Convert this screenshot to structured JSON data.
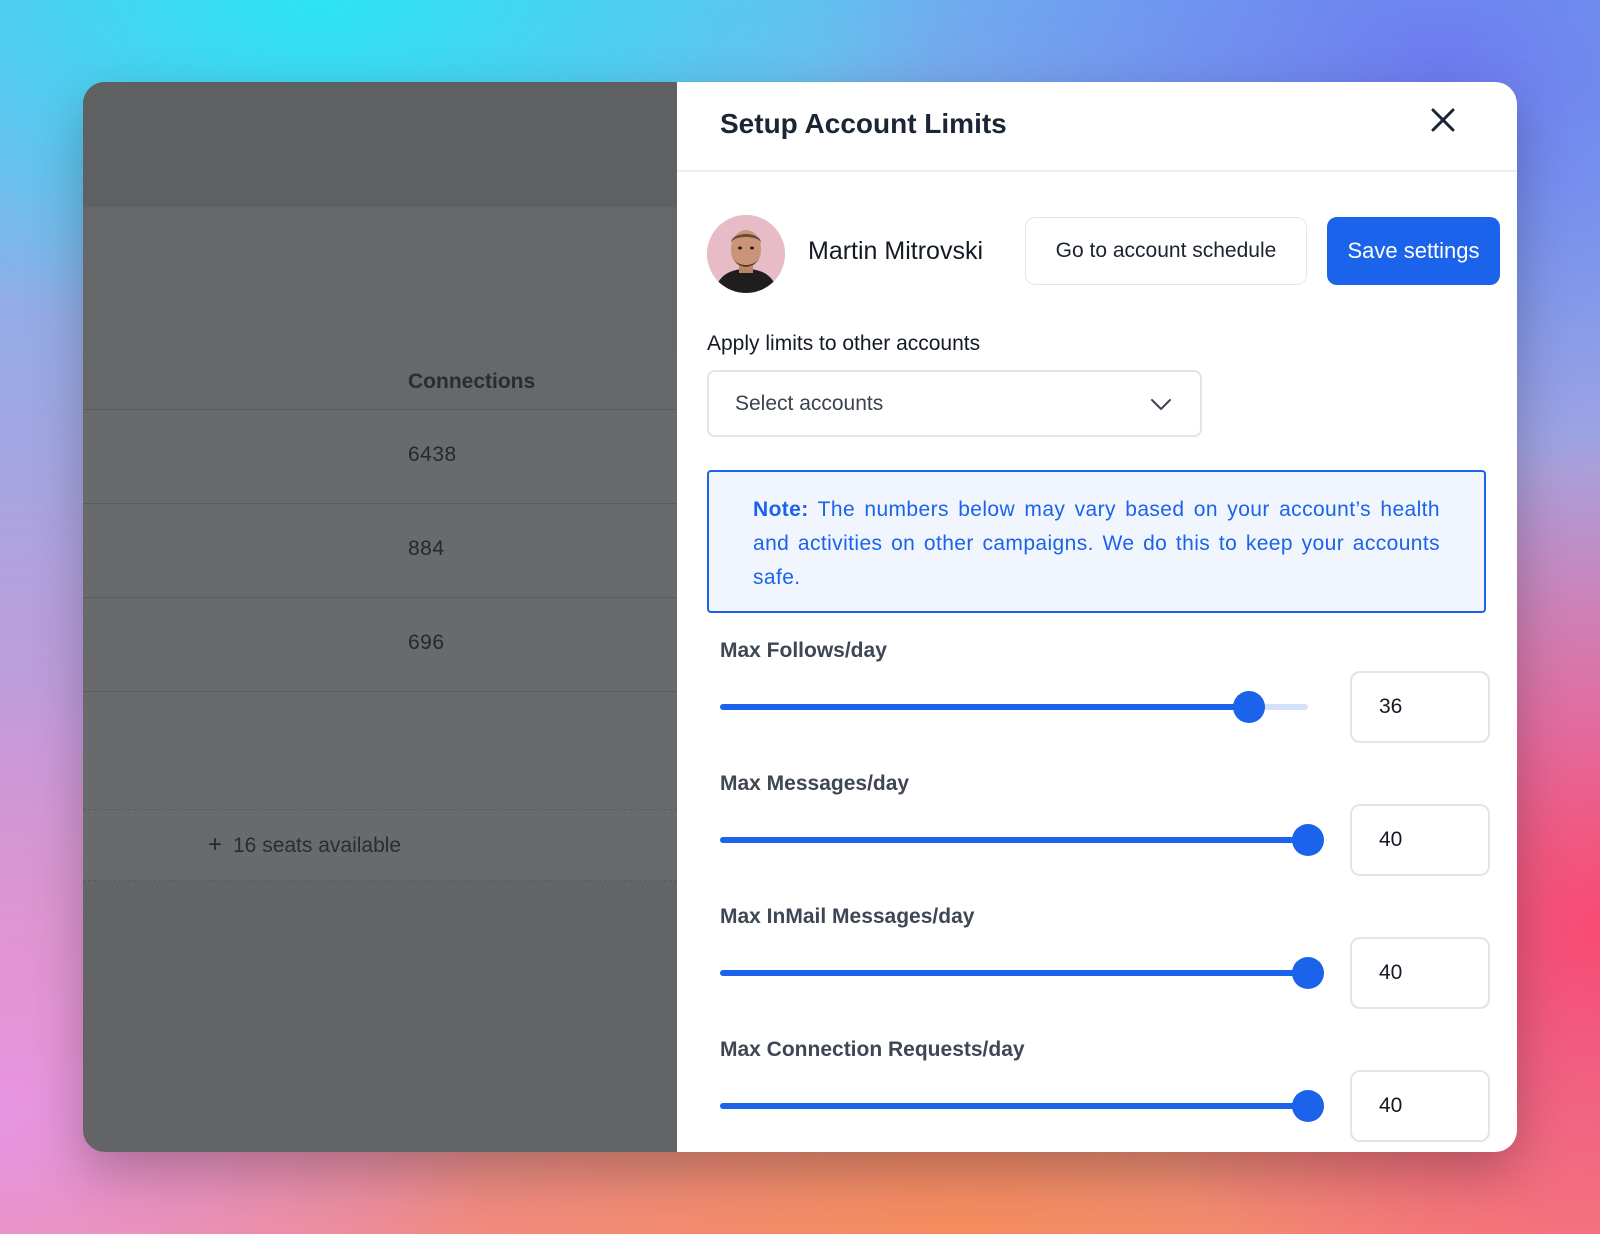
{
  "background_page": {
    "column_header": "Connections",
    "rows": [
      "6438",
      "884",
      "696"
    ],
    "seats_plus": "+",
    "seats_text": "16 seats available"
  },
  "panel": {
    "title": "Setup Account Limits",
    "close_icon": "close-icon",
    "user_name": "Martin Mitrovski",
    "schedule_button": "Go to account schedule",
    "save_button": "Save settings",
    "apply_label": "Apply limits to other accounts",
    "select_placeholder": "Select accounts",
    "note_label": "Note:",
    "note_text": "The numbers below may vary based on your account’s health and activities on other campaigns. We do this to keep your accounts safe."
  },
  "limits": [
    {
      "label": "Max Follows/day",
      "value": "36",
      "slider_fraction": 0.9
    },
    {
      "label": "Max Messages/day",
      "value": "40",
      "slider_fraction": 1.0
    },
    {
      "label": "Max InMail Messages/day",
      "value": "40",
      "slider_fraction": 1.0
    },
    {
      "label": "Max Connection Requests/day",
      "value": "40",
      "slider_fraction": 1.0
    }
  ],
  "colors": {
    "accent": "#1b63ea",
    "note_bg": "#f1f5fd",
    "overlay": "#636466"
  }
}
